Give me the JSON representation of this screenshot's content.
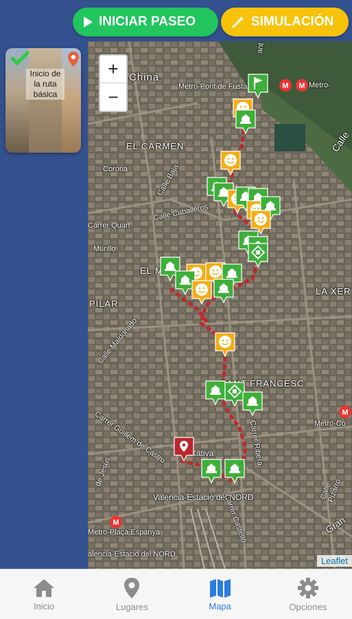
{
  "toolbar": {
    "start_label": "INICIAR PASEO",
    "simulation_label": "SIMULACIÓN"
  },
  "route_card": {
    "caption": "Inicio de la ruta básica"
  },
  "map": {
    "zoom_in": "+",
    "zoom_out": "−",
    "attribution": "Leaflet",
    "labels": {
      "carmen": "EL CARMEN",
      "mercat": "EL M",
      "pilar": "PILAR",
      "xerea": "LA XER",
      "sant_francesc": "SANT FRANCESC",
      "china": "China",
      "metro_pont": "Metro-Pont de Fusta",
      "metro_pont2": "Metro-",
      "calle_caballeros": "Calle Caballeros",
      "calle_baja": "Calle Baja",
      "corona": "Corona",
      "quart": "Carrer Quart",
      "murillo": "Murillo",
      "maldonado": "Calle Maldonado",
      "guillem": "Carrer Guillem de Castro",
      "jesus": "de Jesús",
      "xativa": "Xàtiva",
      "estacio_nord": "Valencia-Estació del NORD",
      "placa_espanya": "Metro-Plaça Espanya",
      "estacio_nord2": "alencia-Estació del NORD",
      "metro_colon": "Metro-Co",
      "pizarro": "Calle Pizarro",
      "castello": "Carrer Castelló",
      "ruzafa": "Carrer Ribera",
      "calle": "Calle",
      "gran": "Gran",
      "sant": "ant"
    }
  },
  "nav": {
    "items": [
      {
        "label": "Inicio",
        "icon": "home-icon"
      },
      {
        "label": "Lugares",
        "icon": "location-icon"
      },
      {
        "label": "Mapa",
        "icon": "map-icon"
      },
      {
        "label": "Opciones",
        "icon": "gear-icon"
      }
    ],
    "active": "Mapa"
  },
  "colors": {
    "primary_green": "#22c55e",
    "simulation_yellow": "#f6c20a",
    "panel_blue": "#34518f",
    "active_nav": "#2a7de1",
    "route_red": "#c0282d"
  }
}
